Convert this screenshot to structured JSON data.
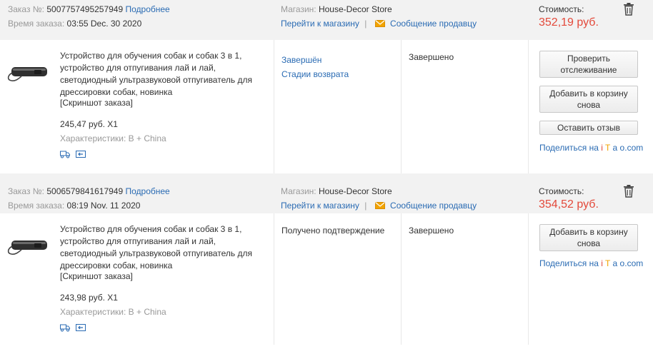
{
  "labels": {
    "order_no": "Заказ №:",
    "order_time": "Время заказа:",
    "details": "Подробнее",
    "store": "Магазин:",
    "go_store": "Перейти к магазину",
    "separator": "|",
    "message_seller": "Сообщение продавцу",
    "cost": "Стоимость:",
    "screenshot": "[Скриншот заказа]",
    "characteristics": "Характеристики:",
    "share_prefix": "Поделиться на",
    "share_i": "i",
    "share_t": "T",
    "share_a": "a",
    "share_o": "o",
    "share_dot": ".",
    "share_com": "com"
  },
  "icons": {
    "trash": "trash-icon",
    "mail": "mail-icon",
    "truck": "truck-icon",
    "return": "return-icon"
  },
  "colors": {
    "price": "#e3493a",
    "link": "#2a6bb3",
    "header_bg": "#f2f2f2",
    "mail_orange": "#f2a300"
  },
  "orders": [
    {
      "number": "5007757495257949",
      "time": "03:55 Dec. 30 2020",
      "store_name": "House-Decor Store",
      "price": "352,19 руб.",
      "product_title": "Устройство для обучения собак и собак 3 в 1, устройство для отпугивания лай и лай, светодиодный ультразвуковой отпугиватель для дрессировки собак, новинка",
      "item_price": "245,47 руб. X1",
      "characteristics": "B + China",
      "status": "Завершён",
      "return_link": "Стадии возврата",
      "state": "Завершено",
      "buttons": [
        "Проверить отслеживание",
        "Добавить в корзину снова",
        "Оставить отзыв"
      ]
    },
    {
      "number": "5006579841617949",
      "time": "08:19 Nov. 11 2020",
      "store_name": "House-Decor Store",
      "price": "354,52 руб.",
      "product_title": "Устройство для обучения собак и собак 3 в 1, устройство для отпугивания лай и лай, светодиодный ультразвуковой отпугиватель для дрессировки собак, новинка",
      "item_price": "243,98 руб. X1",
      "characteristics": "B + China",
      "status": "Получено подтверждение",
      "state": "Завершено",
      "buttons": [
        "Добавить в корзину снова"
      ]
    }
  ]
}
